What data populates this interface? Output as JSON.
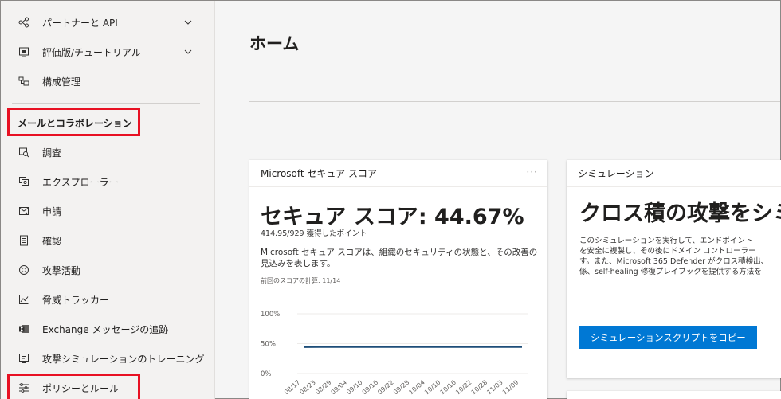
{
  "sidebar": {
    "items": [
      {
        "label": "パートナーと API",
        "icon": "partner-api-icon",
        "chevron": true
      },
      {
        "label": "評価版/チュートリアル",
        "icon": "trial-tutorial-icon",
        "chevron": true
      },
      {
        "label": "構成管理",
        "icon": "configuration-management-icon",
        "chevron": false
      }
    ],
    "section_header": "メールとコラボレーション",
    "section_items": [
      {
        "label": "調査",
        "icon": "investigations-icon"
      },
      {
        "label": "エクスプローラー",
        "icon": "explorer-icon"
      },
      {
        "label": "申請",
        "icon": "submissions-icon"
      },
      {
        "label": "確認",
        "icon": "review-icon"
      },
      {
        "label": "攻撃活動",
        "icon": "campaigns-icon"
      },
      {
        "label": "脅威トラッカー",
        "icon": "threat-tracker-icon"
      },
      {
        "label": "Exchange メッセージの追跡",
        "icon": "exchange-icon"
      },
      {
        "label": "攻撃シミュレーションのトレーニング",
        "icon": "attack-simulation-icon"
      },
      {
        "label": "ポリシーとルール",
        "icon": "policies-rules-icon"
      }
    ],
    "highlight_color": "#e81123"
  },
  "main": {
    "title": "ホーム"
  },
  "secure_score_card": {
    "header": "Microsoft セキュア スコア",
    "more": "···",
    "title": "セキュア スコア: 44.67%",
    "points": "414.95/929 獲得したポイント",
    "description": "Microsoft セキュア スコアは、組織のセキュリティの状態と、その改善の見込みを表します。",
    "last_calc": "前回のスコアの計算: 11/14",
    "chart_data": {
      "type": "line",
      "x": [
        "08/17",
        "08/23",
        "08/29",
        "09/04",
        "09/10",
        "09/16",
        "09/22",
        "09/28",
        "10/04",
        "10/10",
        "10/16",
        "10/22",
        "10/28",
        "11/03",
        "11/09"
      ],
      "series": [
        {
          "values": [
            44.5,
            44.6,
            44.7,
            44.7,
            44.6,
            44.7,
            44.7,
            44.6,
            44.7,
            44.7,
            44.7,
            44.6,
            44.7,
            44.7,
            44.67
          ]
        }
      ],
      "ylim": [
        0,
        100
      ],
      "yticks": [
        "100%",
        "50%",
        "0%"
      ],
      "grid": true,
      "line_color": "#1e4e79"
    }
  },
  "simulation_card": {
    "header": "シミュレーション",
    "title": "クロス積の攻撃をシミ",
    "description": "このシミュレーションを実行して、エンドポイント\nを安全に複製し、その後にドメイン コントローラー\nす。また、Microsoft 365 Defender がクロス積検出、\n係、self-healing 修復プレイブックを提供する方法を",
    "button": "シミュレーションスクリプトをコピー",
    "accent": "#0078d4"
  }
}
